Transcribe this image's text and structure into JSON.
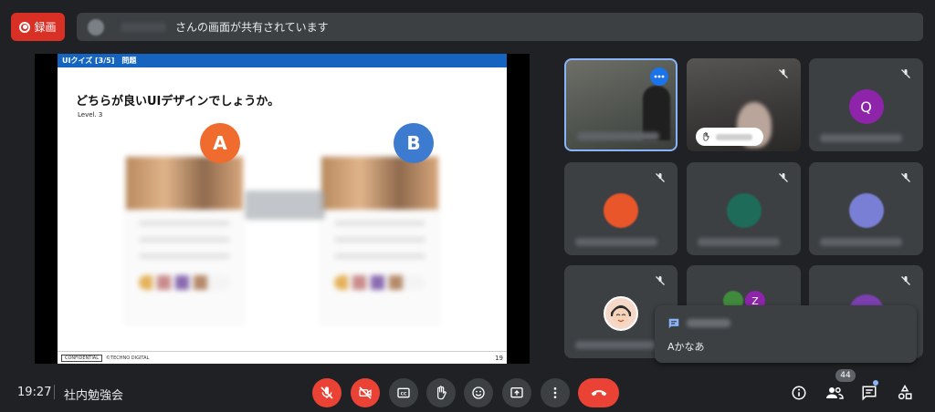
{
  "top": {
    "record_label": "録画",
    "share_text": "さんの画面が共有されています"
  },
  "slide": {
    "header": "UIクイズ [3/5]　問題",
    "title": "どちらが良いUIデザインでしょうか。",
    "level": "Level. 3",
    "option_a": "A",
    "option_b": "B",
    "footer_conf": "CONFIDENTIAL",
    "footer_company": "©TECHNO DIGITAL",
    "page": "19"
  },
  "tiles": {
    "q_initial": "Q",
    "z_initial": "Z",
    "avatar_colors": {
      "q": "#8e24aa",
      "orange": "#e8562a",
      "teal": "#1e6b5a",
      "lavender": "#7a7fd6",
      "purple": "#7b3fb0",
      "green": "#3f8a3c"
    }
  },
  "chat": {
    "message": "Aかなあ"
  },
  "bottom": {
    "time": "19:27",
    "meeting_name": "社内勉強会",
    "participant_count": "44"
  },
  "colors": {
    "background": "#202124",
    "surface": "#3c4043",
    "danger": "#ea4335",
    "accent": "#8ab4f8"
  }
}
